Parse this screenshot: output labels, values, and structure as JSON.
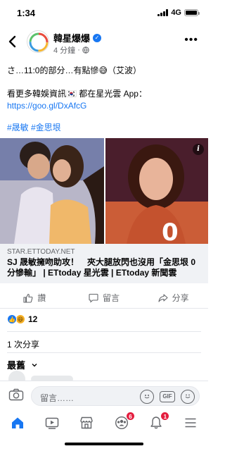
{
  "status": {
    "time": "1:34",
    "network": "4G"
  },
  "header": {
    "page_name": "韓星爆爆",
    "time_ago": "4 分鐘",
    "globe_icon": "globe-icon",
    "more_icon": "more-icon"
  },
  "post": {
    "line1": "さ…11:0的部分…有點慘😅（艾波）",
    "line2_prefix": "看更多韓娛資訊🇰🇷 都在星光雲 App：",
    "line2_link": "https://goo.gl/DxAfcG",
    "tags": "#晟敏 #金思垠"
  },
  "media": {
    "info_badge": "i"
  },
  "preview": {
    "domain": "STAR.ETTODAY.NET",
    "title": "SJ 晟敏擁吻助攻！　夾大腿放閃也沒用「金思垠 0 分慘輸」 | ETtoday 星光雲 | ETtoday 新聞雲"
  },
  "actions": {
    "like": "讚",
    "comment": "留言",
    "share": "分享"
  },
  "reactions": {
    "count": "12"
  },
  "shares": "1 次分享",
  "sort": {
    "label": "最舊"
  },
  "comment_bar": {
    "placeholder": "留言……",
    "gif": "GIF"
  },
  "nav": {
    "groups_badge": "6",
    "notifications_badge": "1"
  },
  "colors": {
    "accent": "#1877f2",
    "badge": "#e41e3f",
    "muted": "#65676b"
  }
}
